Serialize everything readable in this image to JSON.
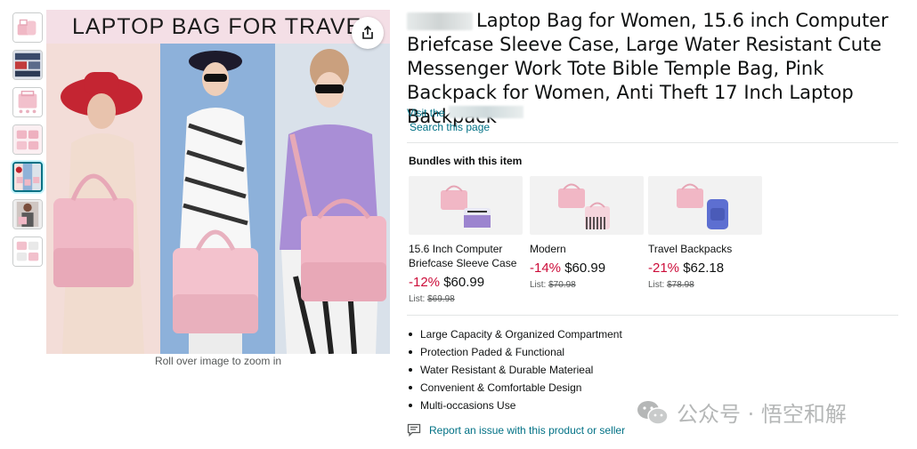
{
  "main_image": {
    "banner_text": "LAPTOP BAG FOR TRAVEL",
    "zoom_hint": "Roll over image to zoom in"
  },
  "thumbnails": [
    "thumb-1",
    "thumb-2",
    "thumb-3",
    "thumb-4",
    "thumb-5",
    "thumb-6",
    "thumb-7"
  ],
  "product": {
    "title": "Laptop Bag for Women, 15.6 inch Computer Briefcase Sleeve Case, Large Water Resistant Cute Messenger Work Tote Bible Temple Bag, Pink Backpack for Women, Anti Theft 17 Inch Laptop Backpack",
    "visit_prefix": "Visit the",
    "search_page": "Search this page"
  },
  "bundles": {
    "heading": "Bundles with this item",
    "items": [
      {
        "name": "15.6 Inch Computer Briefcase Sleeve Case",
        "discount": "-12%",
        "price": "$60.99",
        "list_label": "List:",
        "list_price": "$69.98"
      },
      {
        "name": "Modern",
        "discount": "-14%",
        "price": "$60.99",
        "list_label": "List:",
        "list_price": "$70.98"
      },
      {
        "name": "Travel Backpacks",
        "discount": "-21%",
        "price": "$62.18",
        "list_label": "List:",
        "list_price": "$78.98"
      }
    ]
  },
  "bullets": [
    "Large Capacity & Organized Compartment",
    "Protection Paded & Functional",
    "Water Resistant & Durable Materieal",
    "Convenient & Comfortable Design",
    "Multi-occasions Use"
  ],
  "report_link": "Report an issue with this product or seller",
  "watermark": "公众号 · 悟空和解",
  "colors": {
    "link": "#007185",
    "discount": "#cc0c39",
    "pink": "#f2b8c6",
    "active_thumb_border": "#007185"
  }
}
